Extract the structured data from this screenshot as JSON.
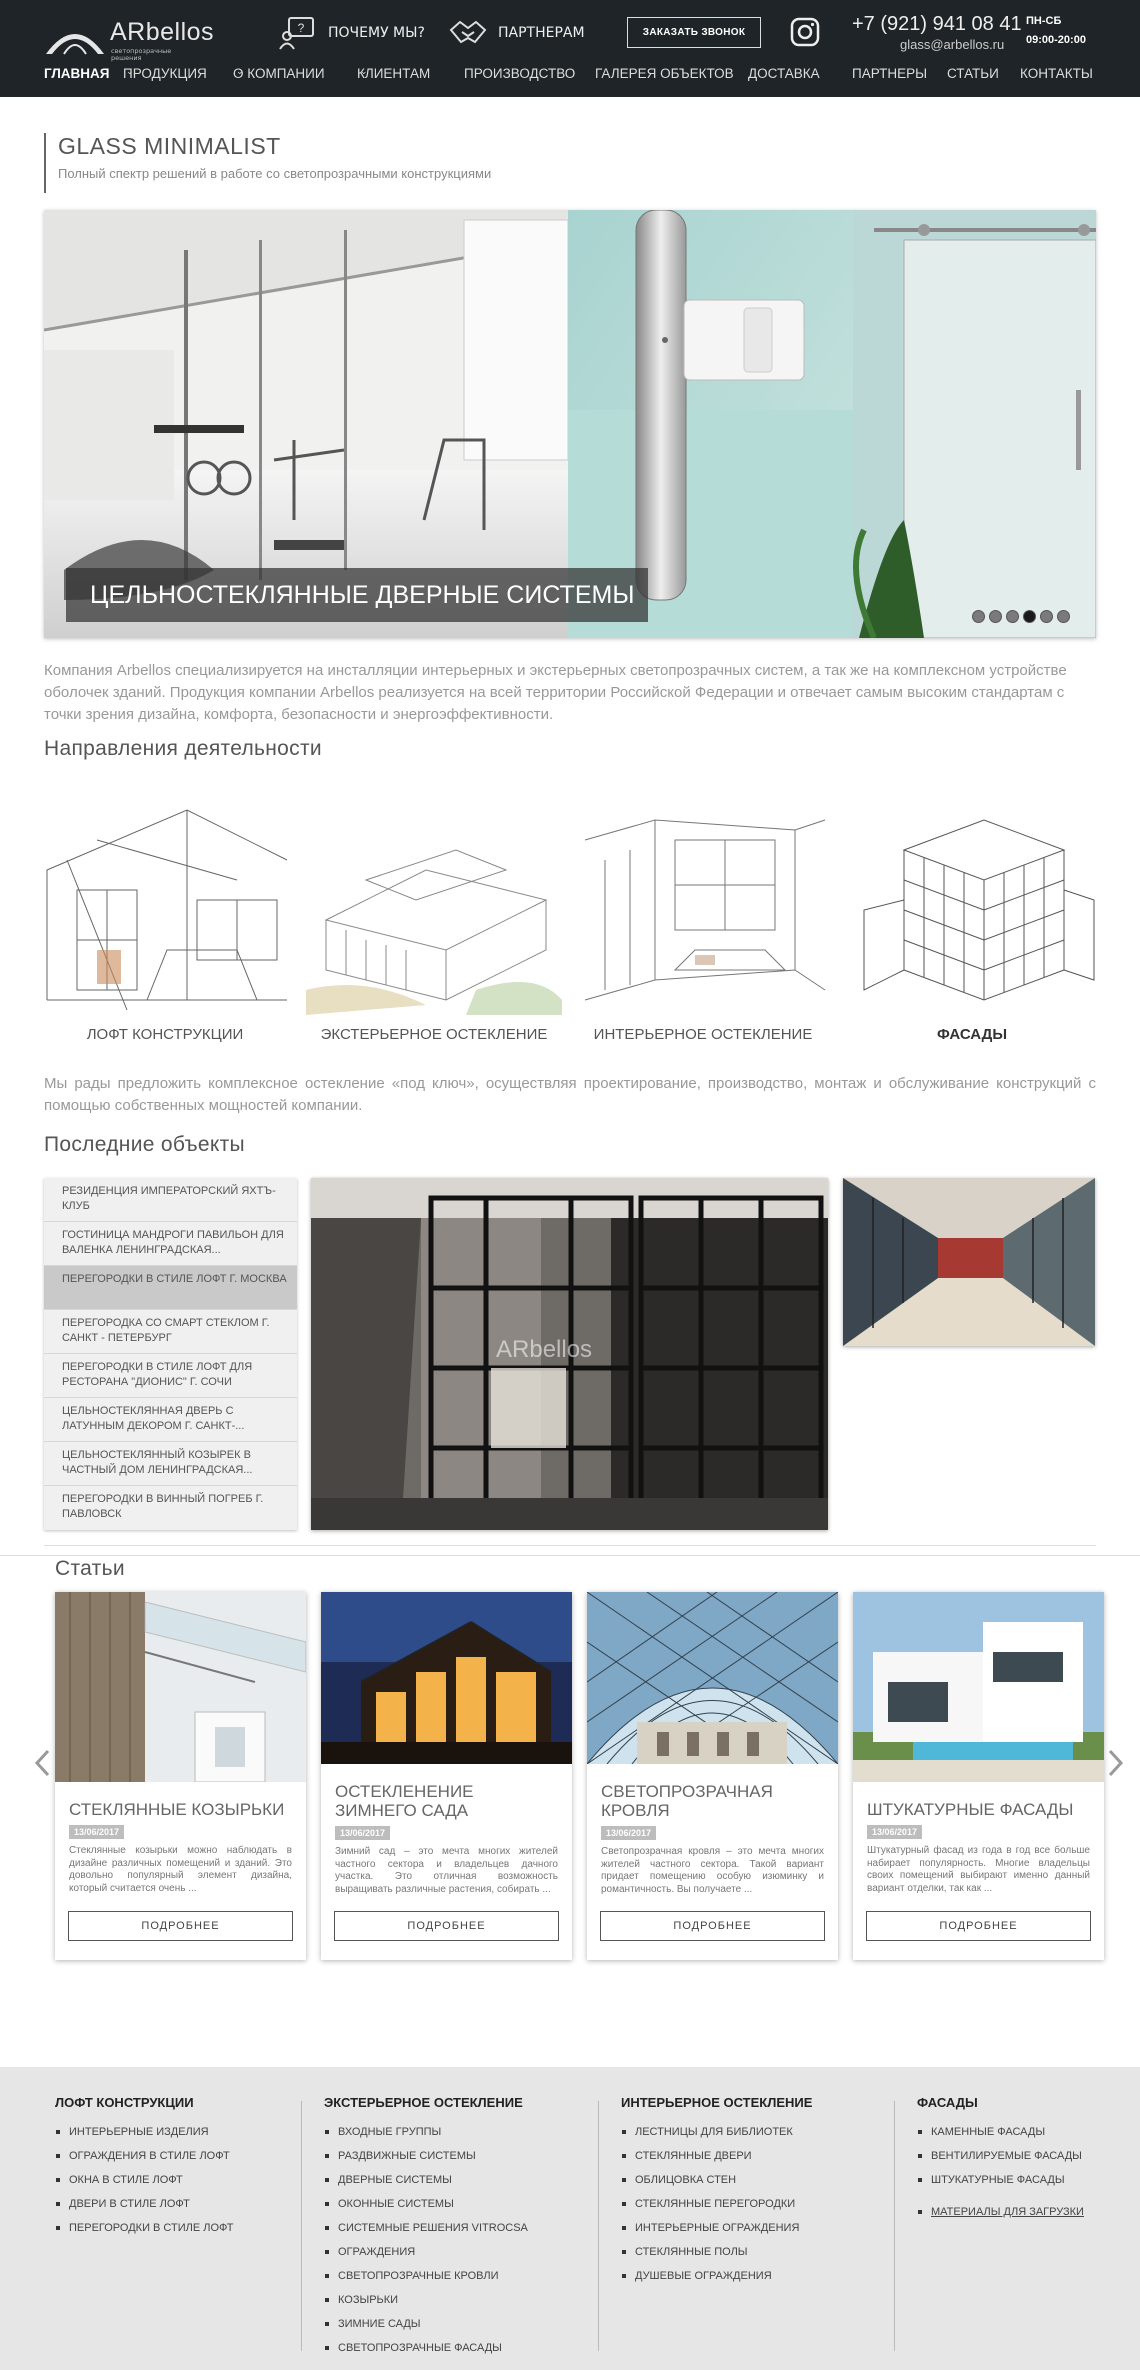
{
  "header": {
    "brand": "ARbellos",
    "tagline": "светопрозрачные решения",
    "why_us": "ПОЧЕМУ МЫ?",
    "partners_link": "ПАРТНЕРАМ",
    "call_button": "ЗАКАЗАТЬ ЗВОНОК",
    "phone": "+7 (921) 941 08 41",
    "email": "glass@arbellos.ru",
    "hours_days": "ПН-СБ",
    "hours_time": "09:00-20:00"
  },
  "nav": {
    "items": [
      {
        "label": "ГЛАВНАЯ"
      },
      {
        "label": "ПРОДУКЦИЯ",
        "caret": "⌄"
      },
      {
        "label": "О КОМПАНИИ",
        "caret": "⌄"
      },
      {
        "label": "КЛИЕНТАМ",
        "caret": "⌄"
      },
      {
        "label": "ПРОИЗВОДСТВО"
      },
      {
        "label": "ГАЛЕРЕЯ ОБЪЕКТОВ"
      },
      {
        "label": "ДОСТАВКА"
      },
      {
        "label": "ПАРТНЕРЫ"
      },
      {
        "label": "СТАТЬИ"
      },
      {
        "label": "КОНТАКТЫ"
      }
    ]
  },
  "title": {
    "heading": "GLASS MINIMALIST",
    "subheading": "Полный спектр решений в работе со светопрозрачными конструкциями"
  },
  "slider": {
    "caption": "ЦЕЛЬНОСТЕКЛЯННЫЕ ДВЕРНЫЕ СИСТЕМЫ",
    "dot_count": 6,
    "active_dot": 3
  },
  "intro": "Компания Arbellos специализируется на инсталляции  интерьерных и экстерьерных светопрозрачных систем, а так же на комплексном устройстве оболочек зданий. Продукция компании Arbellos реализуется на всей территории Российской Федерации и отвечает самым высоким стандартам с точки зрения дизайна, комфорта, безопасности и энергоэффективности.",
  "directions": {
    "heading": "Направления деятельности",
    "items": [
      {
        "label": "ЛОФТ КОНСТРУКЦИИ"
      },
      {
        "label": "ЭКСТЕРЬЕРНОЕ ОСТЕКЛЕНИЕ"
      },
      {
        "label": "ИНТЕРЬЕРНОЕ ОСТЕКЛЕНИЕ"
      },
      {
        "label": "ФАСАДЫ"
      }
    ]
  },
  "offer": "Мы рады предложить комплексное остекление «под ключ», осуществляя проектирование, производство, монтаж и обслуживание конструкций с помощью собственных мощностей компании.",
  "objects": {
    "heading": "Последние объекты",
    "items": [
      {
        "label": "РЕЗИДЕНЦИЯ ИМПЕРАТОРСКИЙ ЯХТЪ-КЛУБ"
      },
      {
        "label": "ГОСТИНИЦА МАНДРОГИ ПАВИЛЬОН ДЛЯ ВАЛЕНКА ЛЕНИНГРАДСКАЯ..."
      },
      {
        "label": "ПЕРЕГОРОДКИ В СТИЛЕ ЛОФТ Г. МОСКВА"
      },
      {
        "label": "ПЕРЕГОРОДКА СО СМАРТ СТЕКЛОМ Г. САНКТ - ПЕТЕРБУРГ"
      },
      {
        "label": "ПЕРЕГОРОДКИ В СТИЛЕ ЛОФТ ДЛЯ РЕСТОРАНА \"ДИОНИС\" Г. СОЧИ"
      },
      {
        "label": "ЦЕЛЬНОСТЕКЛЯННАЯ ДВЕРЬ С ЛАТУННЫМ ДЕКОРОМ Г. САНКТ-..."
      },
      {
        "label": "ЦЕЛЬНОСТЕКЛЯННЫЙ КОЗЫРЕК В ЧАСТНЫЙ ДОМ ЛЕНИНГРАДСКАЯ..."
      },
      {
        "label": "ПЕРЕГОРОДКИ В ВИННЫЙ ПОГРЕБ Г. ПАВЛОВСК"
      }
    ],
    "selected_index": 2,
    "watermark": "ARbellos"
  },
  "articles": {
    "heading": "Статьи",
    "more_label": "ПОДРОБНЕЕ",
    "items": [
      {
        "title": "СТЕКЛЯННЫЕ КОЗЫРЬКИ",
        "date": "13/06/2017",
        "text": "Стеклянные козырьки можно наблюдать в дизайне различных помещений и зданий. Это довольно популярный элемент дизайна, который считается очень ..."
      },
      {
        "title": "ОСТЕКЛЕНЕНИЕ ЗИМНЕГО САДА",
        "date": "13/06/2017",
        "text": "Зимний сад – это мечта многих жителей частного сектора и владельцев дачного участка. Это отличная возможность выращивать различные растения, собирать ..."
      },
      {
        "title": "СВЕТОПРОЗРАЧНАЯ КРОВЛЯ",
        "date": "13/06/2017",
        "text": "Светопрозрачная кровля – это мечта многих жителей частного сектора. Такой вариант придает помещению особую изюминку и романтичность. Вы получаете ..."
      },
      {
        "title": "ШТУКАТУРНЫЕ ФАСАДЫ",
        "date": "13/06/2017",
        "text": "Штукатурный фасад из года в год все больше набирает популярность. Многие владельцы своих помещений выбирают именно данный вариант отделки, так как ..."
      }
    ]
  },
  "footer": {
    "columns": [
      {
        "heading": "ЛОФТ КОНСТРУКЦИИ",
        "items": [
          "ИНТЕРЬЕРНЫЕ ИЗДЕЛИЯ",
          "ОГРАЖДЕНИЯ В СТИЛЕ ЛОФТ",
          "ОКНА В СТИЛЕ ЛОФТ",
          "ДВЕРИ В СТИЛЕ ЛОФТ",
          "ПЕРЕГОРОДКИ В СТИЛЕ ЛОФТ"
        ]
      },
      {
        "heading": "ЭКСТЕРЬЕРНОЕ ОСТЕКЛЕНИЕ",
        "items": [
          "ВХОДНЫЕ ГРУППЫ",
          "РАЗДВИЖНЫЕ СИСТЕМЫ",
          "ДВЕРНЫЕ СИСТЕМЫ",
          "ОКОННЫЕ СИСТЕМЫ",
          "СИСТЕМНЫЕ РЕШЕНИЯ VITROCSA",
          "ОГРАЖДЕНИЯ",
          "СВЕТОПРОЗРАЧНЫЕ КРОВЛИ",
          "КОЗЫРЬКИ",
          "ЗИМНИЕ САДЫ",
          "СВЕТОПРОЗРАЧНЫЕ ФАСАДЫ"
        ]
      },
      {
        "heading": "ИНТЕРЬЕРНОЕ ОСТЕКЛЕНИЕ",
        "items": [
          "ЛЕСТНИЦЫ ДЛЯ БИБЛИОТЕК",
          "СТЕКЛЯННЫЕ ДВЕРИ",
          "ОБЛИЦОВКА СТЕН",
          "СТЕКЛЯННЫЕ ПЕРЕГОРОДКИ",
          "ИНТЕРЬЕРНЫЕ ОГРАЖДЕНИЯ",
          "СТЕКЛЯННЫЕ ПОЛЫ",
          "ДУШЕВЫЕ ОГРАЖДЕНИЯ"
        ]
      },
      {
        "heading": "ФАСАДЫ",
        "items": [
          "КАМЕННЫЕ ФАСАДЫ",
          "ВЕНТИЛИРУЕМЫЕ ФАСАДЫ",
          "ШТУКАТУРНЫЕ ФАСАДЫ"
        ],
        "link": "МАТЕРИАЛЫ ДЛЯ ЗАГРУЗКИ"
      }
    ]
  },
  "colors": {
    "header_bg": "#1e2427",
    "footer_bg": "#e6e6e6",
    "date_badge": "#bdbdbd"
  }
}
